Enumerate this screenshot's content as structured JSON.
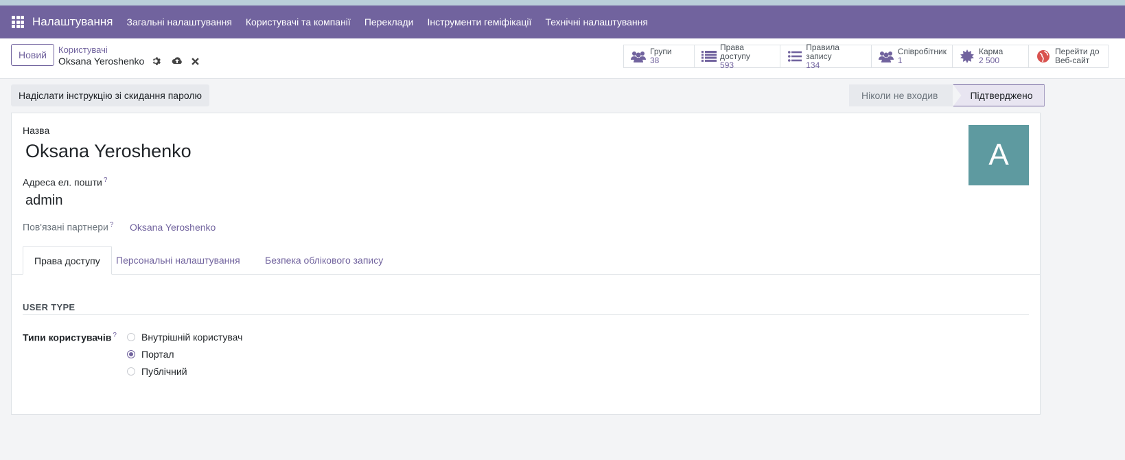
{
  "navbar": {
    "app_title": "Налаштування",
    "menu": [
      "Загальні налаштування",
      "Користувачі та компанії",
      "Переклади",
      "Інструменти геміфікації",
      "Технічні налаштування"
    ]
  },
  "control": {
    "new_button": "Новий",
    "breadcrumb_parent": "Користувачі",
    "record_title": "Oksana Yeroshenko"
  },
  "stats": [
    {
      "icon": "users-icon",
      "label": "Групи",
      "value": "38"
    },
    {
      "icon": "list-icon",
      "label": "Права доступу",
      "value": "593"
    },
    {
      "icon": "list-icon",
      "label": "Правила запису",
      "value": "134"
    },
    {
      "icon": "users-icon",
      "label": "Співробітник",
      "value": "1"
    },
    {
      "icon": "karma-icon",
      "label": "Карма",
      "value": "2 500"
    },
    {
      "icon": "globe-icon",
      "label": "Перейти до",
      "value": "Веб-сайт"
    }
  ],
  "actions": {
    "reset_password": "Надіслати інструкцію зі скидання паролю"
  },
  "status": {
    "never_logged": "Ніколи не входив",
    "confirmed": "Підтверджено"
  },
  "form": {
    "name_label": "Назва",
    "name_value": "Oksana Yeroshenko",
    "email_label": "Адреса ел. пошти",
    "email_value": "admin",
    "partner_label": "Пов'язані партнери",
    "partner_value": "Oksana Yeroshenko",
    "avatar_letter": "A",
    "help_mark": "?"
  },
  "tabs": [
    "Права доступу",
    "Персональні налаштування",
    "Безпека облікового запису"
  ],
  "access": {
    "section_title": "USER TYPE",
    "user_types_label": "Типи користувачів",
    "options": [
      "Внутрішній користувач",
      "Портал",
      "Публічний"
    ],
    "selected": "Портал"
  },
  "colors": {
    "brand": "#71639e",
    "avatar_bg": "#5e9aa0"
  }
}
